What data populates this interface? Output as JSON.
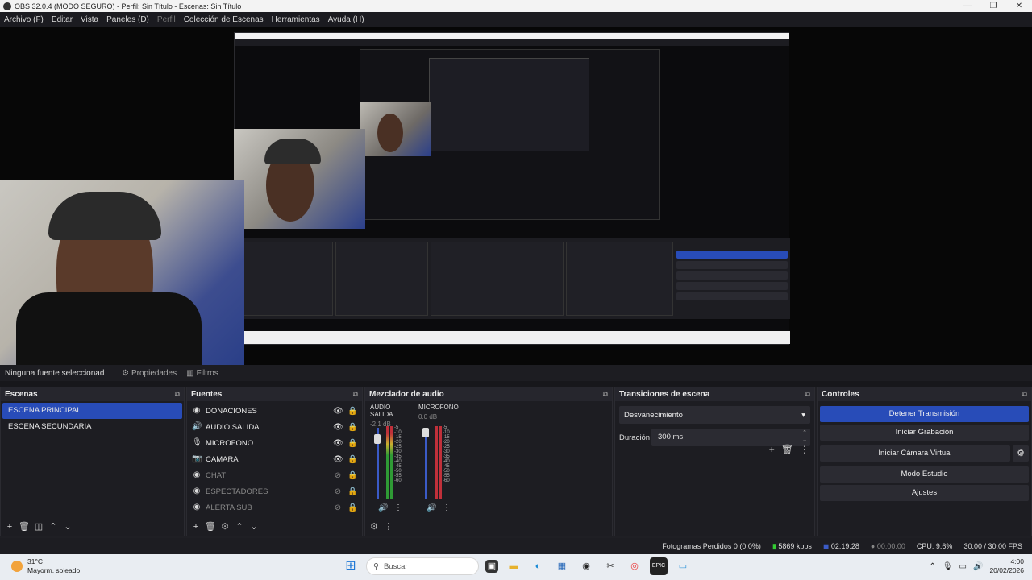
{
  "window": {
    "title": "OBS 32.0.4 (MODO SEGURO) - Perfil: Sin Título - Escenas: Sin Título",
    "controls": [
      "—",
      "❐",
      "✕"
    ]
  },
  "menu": [
    "Archivo (F)",
    "Editar",
    "Vista",
    "Paneles (D)",
    "Perfil",
    "Colección de Escenas",
    "Herramientas",
    "Ayuda (H)"
  ],
  "propbar": {
    "no_source": "Ninguna fuente seleccionad",
    "properties": "Propiedades",
    "filters": "Filtros"
  },
  "scenes": {
    "title": "Escenas",
    "items": [
      "ESCENA PRINCIPAL",
      "ESCENA SECUNDARIA"
    ]
  },
  "sources": {
    "title": "Fuentes",
    "items": [
      {
        "label": "DONACIONES",
        "icon": "globe-icon",
        "visible": true
      },
      {
        "label": "AUDIO SALIDA",
        "icon": "speaker-icon",
        "visible": true
      },
      {
        "label": "MICROFONO",
        "icon": "mic-icon",
        "visible": true
      },
      {
        "label": "CAMARA",
        "icon": "camera-icon",
        "visible": true
      },
      {
        "label": "CHAT",
        "icon": "globe-icon",
        "visible": false
      },
      {
        "label": "ESPECTADORES",
        "icon": "globe-icon",
        "visible": false
      },
      {
        "label": "ALERTA SUB",
        "icon": "globe-icon",
        "visible": false
      }
    ]
  },
  "mixer": {
    "title": "Mezclador de audio",
    "channels": [
      {
        "name": "AUDIO SALIDA",
        "db": "-2.1 dB"
      },
      {
        "name": "MICROFONO",
        "db": "0.0 dB"
      }
    ],
    "scale": [
      "-5",
      "-10",
      "-15",
      "-20",
      "-25",
      "-30",
      "-35",
      "-40",
      "-45",
      "-50",
      "-55",
      "-60"
    ]
  },
  "transitions": {
    "title": "Transiciones de escena",
    "selected": "Desvanecimiento",
    "duration_label": "Duración",
    "duration_value": "300 ms"
  },
  "controls": {
    "title": "Controles",
    "stop_stream": "Detener Transmisión",
    "start_record": "Iniciar Grabación",
    "virtual_cam": "Iniciar Cámara Virtual",
    "studio_mode": "Modo Estudio",
    "settings": "Ajustes"
  },
  "status": {
    "dropped": "Fotogramas Perdidos 0 (0.0%)",
    "bitrate": "5869 kbps",
    "stream_time": "02:19:28",
    "record_time": "00:00:00",
    "cpu": "CPU: 9.6%",
    "fps": "30.00 / 30.00 FPS"
  },
  "taskbar": {
    "temp": "31°C",
    "weather": "Mayorm. soleado",
    "search": "Buscar",
    "time": "4:00",
    "date": "20/02/2026"
  },
  "colors": {
    "accent": "#284cb8",
    "bg": "#1d1d22"
  }
}
